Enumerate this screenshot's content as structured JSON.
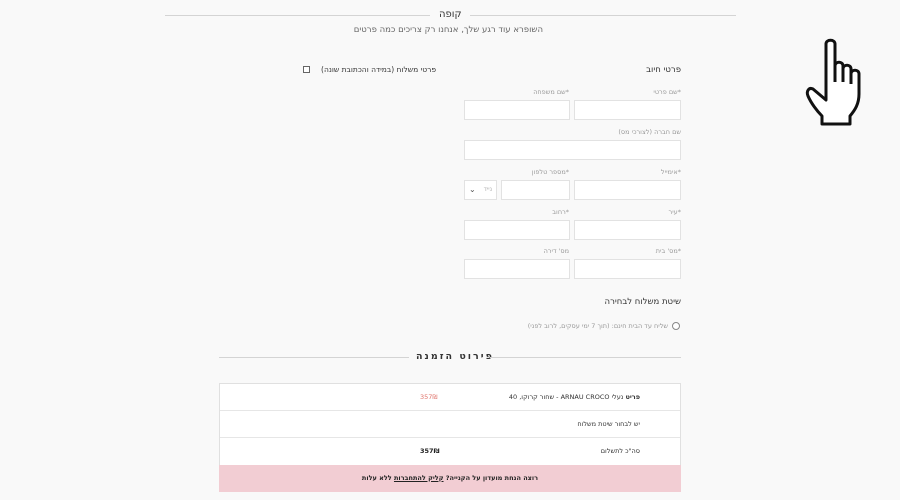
{
  "header": {
    "title": "קופה",
    "subtitle": "השופרא עוד רגע שלך, אנחנו רק צריכים כמה פרטים"
  },
  "billing": {
    "heading": "פרטי חיוב",
    "ship_different_label": "פרטי משלוח (במידה והכתובת שונה)",
    "fields": {
      "first_name": "*שם פרטי",
      "last_name": "*שם משפחה",
      "company": "שם חברה (לצורכי מס)",
      "email": "*אימייל",
      "phone": "*מספר טלפון",
      "phone_prefix": "נייד",
      "city": "*עיר",
      "street": "*רחוב",
      "house_no": "*מס' בית",
      "apt_no": "מס' דירה"
    }
  },
  "shipping": {
    "heading": "שיטת משלוח לבחירה",
    "option_label": "שליח עד הבית חינם: (תוך 7 ימי עסקים, לרוב לפני)"
  },
  "order": {
    "heading": "פירוט הזמנה",
    "product_bold": "פריט",
    "product_name": "נעלי ARNAU CROCO - שחור קרוקו, 40",
    "product_price": "357₪",
    "shipping_row": "יש לבחור שיטת משלוח",
    "total_label": "סה\"כ לתשלום",
    "total_value": "357₪",
    "promo_prefix": "רוצה הנחת מועדון על הקנייה?",
    "promo_link": "קליק להתחברות",
    "promo_suffix": "ללא עלות"
  },
  "colors": {
    "accent_price": "#e0736b",
    "promo_bg": "#f2cdd3"
  },
  "icons": {
    "cursor": "hand-pointer-icon"
  }
}
